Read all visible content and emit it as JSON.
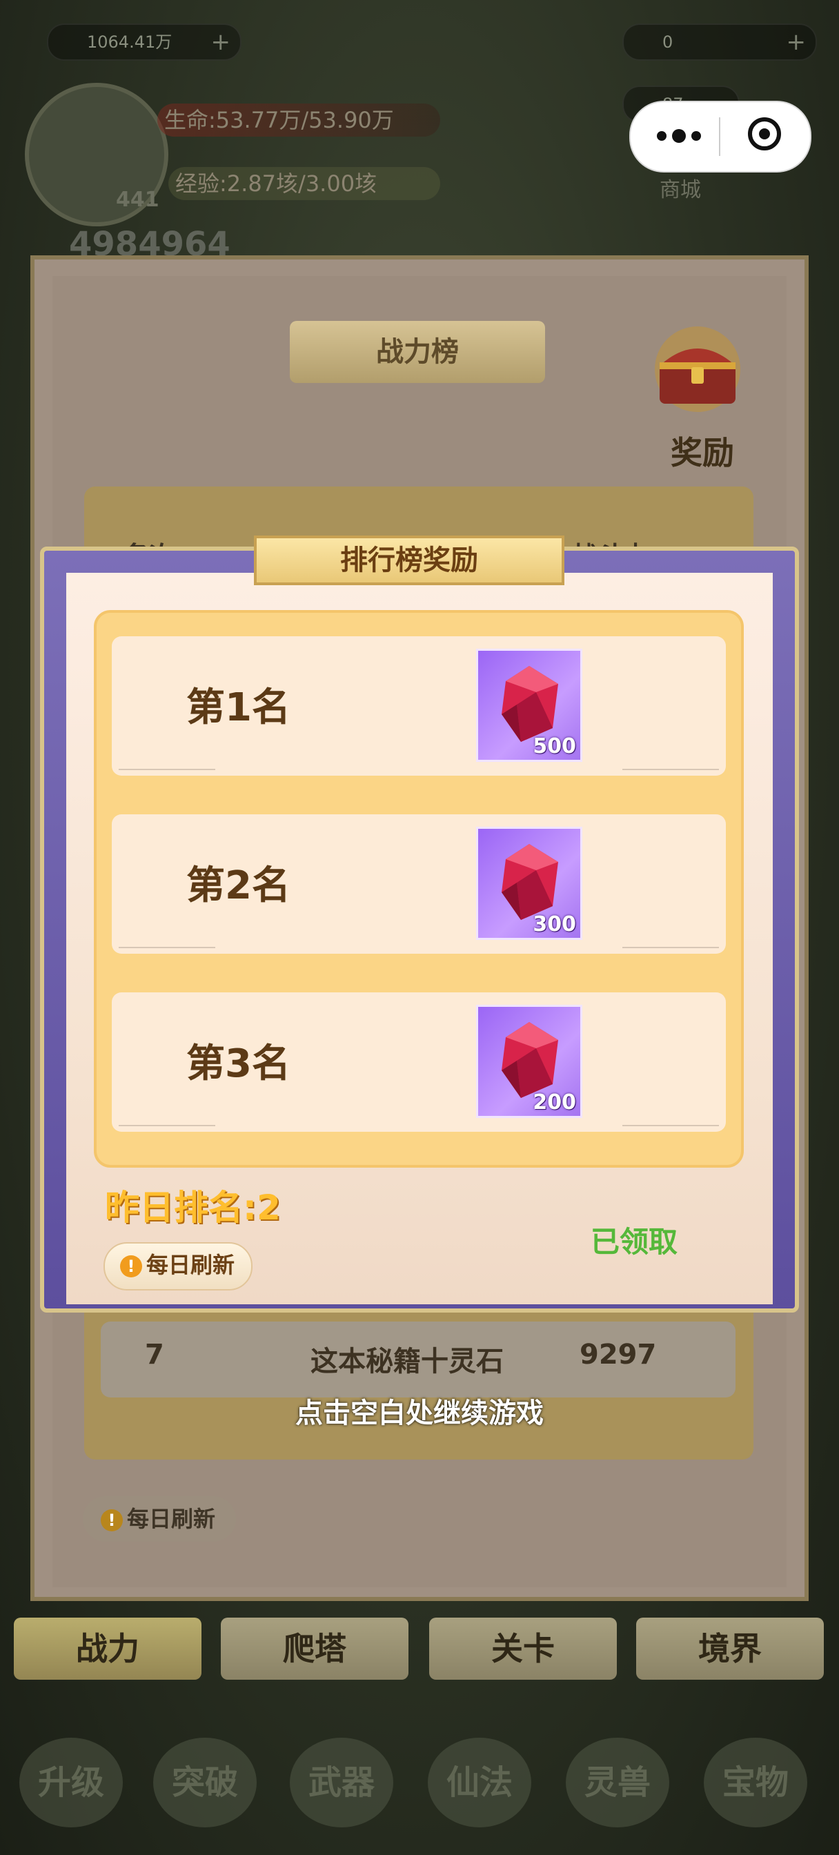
{
  "hud": {
    "currency_left": "1064.41万",
    "gems": "0",
    "second_currency": "87",
    "hp": "生命:53.77万/53.90万",
    "exp": "经验:2.87垓/3.00垓",
    "level": "441",
    "power": "4984964",
    "shop_label": "商城"
  },
  "leaderboard": {
    "title": "战力榜",
    "reward_label": "奖励",
    "header_name": "名次",
    "header_power": "战斗力",
    "visible_row": {
      "rank": "7",
      "name": "这本秘籍十灵石",
      "power": "9297"
    },
    "continue_hint": "点击空白处继续游戏",
    "daily_refresh": "每日刷新",
    "tabs": [
      "战力",
      "爬塔",
      "关卡",
      "境界"
    ]
  },
  "modal": {
    "title": "排行榜奖励",
    "rewards": [
      {
        "rank": "第1名",
        "item_icon": "red-gem-icon",
        "count": "500"
      },
      {
        "rank": "第2名",
        "item_icon": "red-gem-icon",
        "count": "300"
      },
      {
        "rank": "第3名",
        "item_icon": "red-gem-icon",
        "count": "200"
      }
    ],
    "yesterday_rank": "昨日排名:2",
    "claimed": "已领取",
    "daily_refresh": "每日刷新"
  },
  "bottom_nav": [
    "升级",
    "突破",
    "武器",
    "仙法",
    "灵兽",
    "宝物"
  ],
  "colors": {
    "modal_frame": "#6a5cb0",
    "reward_panel": "#fbd586",
    "claimed_green": "#55b83a",
    "rank_yellow": "#ffbe2e"
  }
}
